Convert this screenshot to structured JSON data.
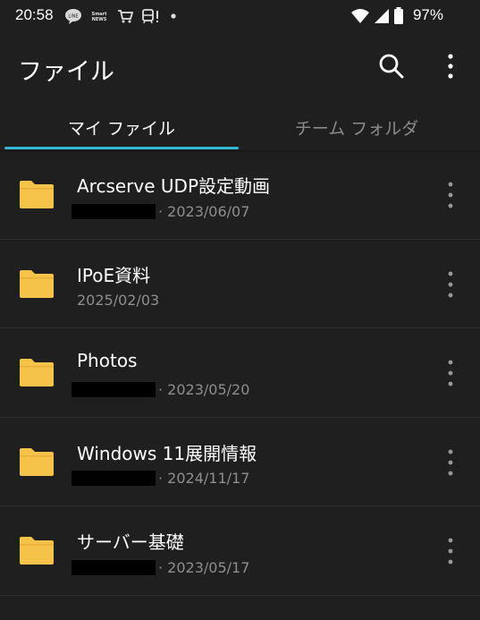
{
  "status_bar": {
    "time": "20:58",
    "battery_pct": "97%",
    "icons_left": [
      "line-icon",
      "smart-news-icon",
      "cart-icon",
      "transit-alert-icon",
      "dot-icon"
    ],
    "icons_right": [
      "wifi-icon",
      "cellular-icon",
      "battery-icon"
    ]
  },
  "app_bar": {
    "title": "ファイル",
    "actions": [
      "search-icon",
      "more-vert-icon"
    ]
  },
  "tabs": [
    {
      "label": "マイ ファイル",
      "active": true
    },
    {
      "label": "チーム フォルダ",
      "active": false
    }
  ],
  "accent_color": "#35b8d8",
  "folder_color": "#f5c24a",
  "files": [
    {
      "name": "Arcserve UDP設定動画",
      "date": "· 2023/06/07",
      "owner_redacted": true
    },
    {
      "name": "IPoE資料",
      "date": "2025/02/03",
      "owner_redacted": false
    },
    {
      "name": "Photos",
      "date": "· 2023/05/20",
      "owner_redacted": true
    },
    {
      "name": "Windows 11展開情報",
      "date": "· 2024/11/17",
      "owner_redacted": true
    },
    {
      "name": "サーバー基礎",
      "date": "· 2023/05/17",
      "owner_redacted": true
    }
  ]
}
